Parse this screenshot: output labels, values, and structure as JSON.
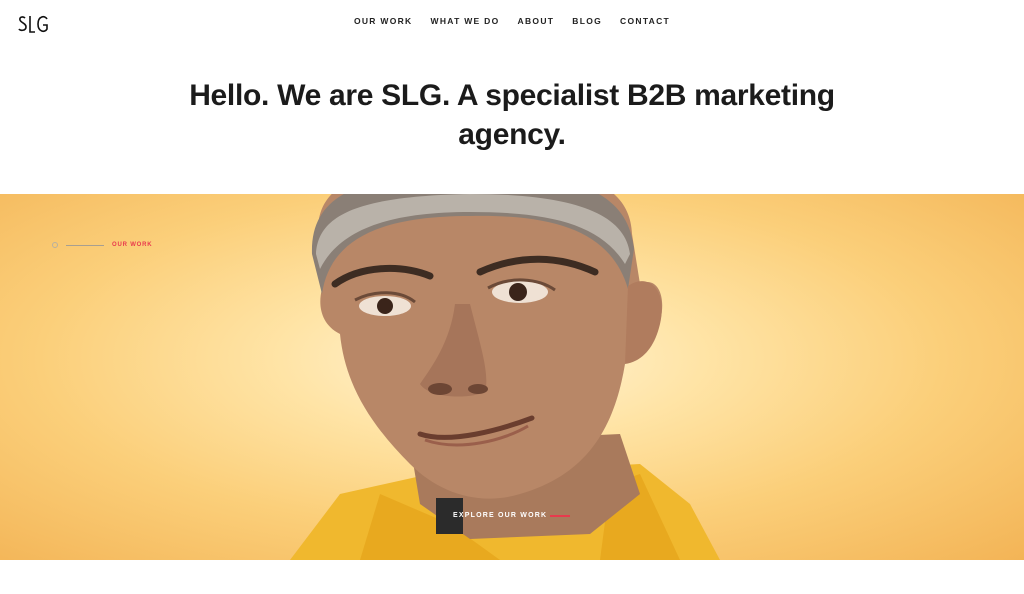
{
  "brand": {
    "logo_text": "SLG"
  },
  "nav": {
    "items": [
      {
        "label": "OUR WORK"
      },
      {
        "label": "WHAT WE DO"
      },
      {
        "label": "ABOUT"
      },
      {
        "label": "BLOG"
      },
      {
        "label": "CONTACT"
      }
    ]
  },
  "hero_heading": "Hello. We are SLG. A specialist B2B marketing agency.",
  "hero": {
    "section_label": "OUR WORK",
    "cta_label": "EXPLORE OUR WORK"
  },
  "colors": {
    "accent": "#e83a4d",
    "text": "#1b1b1b",
    "cta_bg": "#2b2b2b",
    "hero_bg": "#fbcf7a"
  }
}
